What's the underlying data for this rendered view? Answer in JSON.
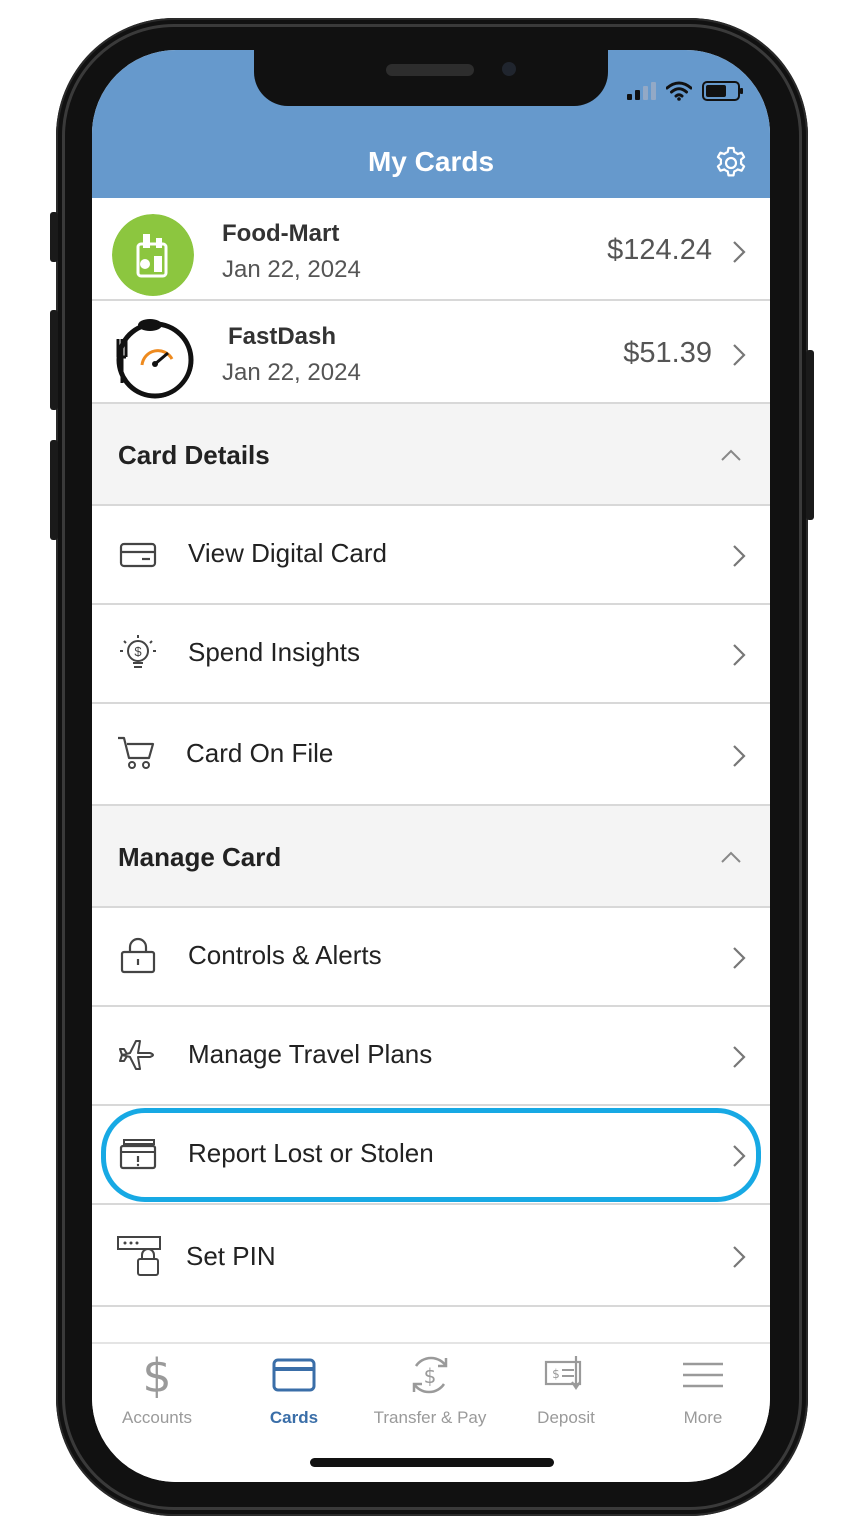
{
  "header": {
    "title": "My Cards",
    "settings_icon": "gear-icon",
    "bg_color": "#6699cc"
  },
  "transactions": [
    {
      "merchant": "Food-Mart",
      "date": "Jan 22, 2024",
      "amount": "$124.24",
      "logo": "grocery-bag-logo"
    },
    {
      "merchant": "FastDash",
      "date": "Jan 22, 2024",
      "amount": "$51.39",
      "logo": "fork-clock-logo"
    }
  ],
  "card_details": {
    "title": "Card Details",
    "items": [
      {
        "label": "View Digital Card",
        "icon": "credit-card-icon"
      },
      {
        "label": "Spend Insights",
        "icon": "lightbulb-dollar-icon"
      },
      {
        "label": "Card On File",
        "icon": "shopping-cart-icon"
      }
    ]
  },
  "manage_card": {
    "title": "Manage Card",
    "items": [
      {
        "label": "Controls & Alerts",
        "icon": "lock-icon"
      },
      {
        "label": "Manage Travel Plans",
        "icon": "airplane-icon"
      },
      {
        "label": "Report Lost or Stolen",
        "icon": "card-alert-icon"
      },
      {
        "label": "Set PIN",
        "icon": "pin-lock-icon"
      }
    ]
  },
  "tabs": [
    {
      "label": "Accounts",
      "icon": "dollar-icon",
      "active": false
    },
    {
      "label": "Cards",
      "icon": "card-icon",
      "active": true
    },
    {
      "label": "Transfer & Pay",
      "icon": "transfer-dollar-icon",
      "active": false
    },
    {
      "label": "Deposit",
      "icon": "check-deposit-icon",
      "active": false
    },
    {
      "label": "More",
      "icon": "menu-icon",
      "active": false
    }
  ],
  "colors": {
    "accent": "#3a6ea8",
    "highlight_ring": "#17a9e4",
    "food_mart_green": "#8cc63f"
  }
}
